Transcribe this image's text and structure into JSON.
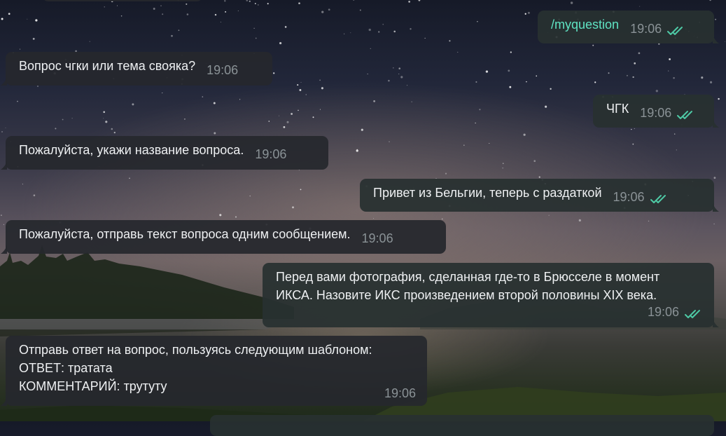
{
  "colors": {
    "bubble_in": "#26282d",
    "bubble_out": "#283030",
    "text": "#eef0f2",
    "time": "#8a9296",
    "read_check": "#4ec9a5",
    "command_link": "#5fe3c3"
  },
  "messages": [
    {
      "direction": "outgoing",
      "text": "/myquestion",
      "is_command": true,
      "time": "19:06",
      "status_icon": "double-check-icon"
    },
    {
      "direction": "incoming",
      "text": "Вопрос чгки или тема свояка?",
      "time": "19:06"
    },
    {
      "direction": "outgoing",
      "text": "ЧГК",
      "time": "19:06",
      "status_icon": "double-check-icon"
    },
    {
      "direction": "incoming",
      "text": "Пожалуйста, укажи название вопроса.",
      "time": "19:06"
    },
    {
      "direction": "outgoing",
      "text": "Привет из Бельгии, теперь с раздаткой",
      "time": "19:06",
      "status_icon": "double-check-icon"
    },
    {
      "direction": "incoming",
      "text": "Пожалуйста, отправь текст вопроса одним сообщением.",
      "time": "19:06"
    },
    {
      "direction": "outgoing",
      "text": "Перед вами фотография, сделанная где-то в Брюсселе в момент\nИКСА. Назовите ИКС произведением второй половины XIX века.",
      "time": "19:06",
      "status_icon": "double-check-icon"
    },
    {
      "direction": "incoming",
      "text": "Отправь ответ на вопрос, пользуясь следующим шаблоном:\nОТВЕТ: тратата\nКОММЕНТАРИЙ: трутуту",
      "time": "19:06"
    }
  ]
}
